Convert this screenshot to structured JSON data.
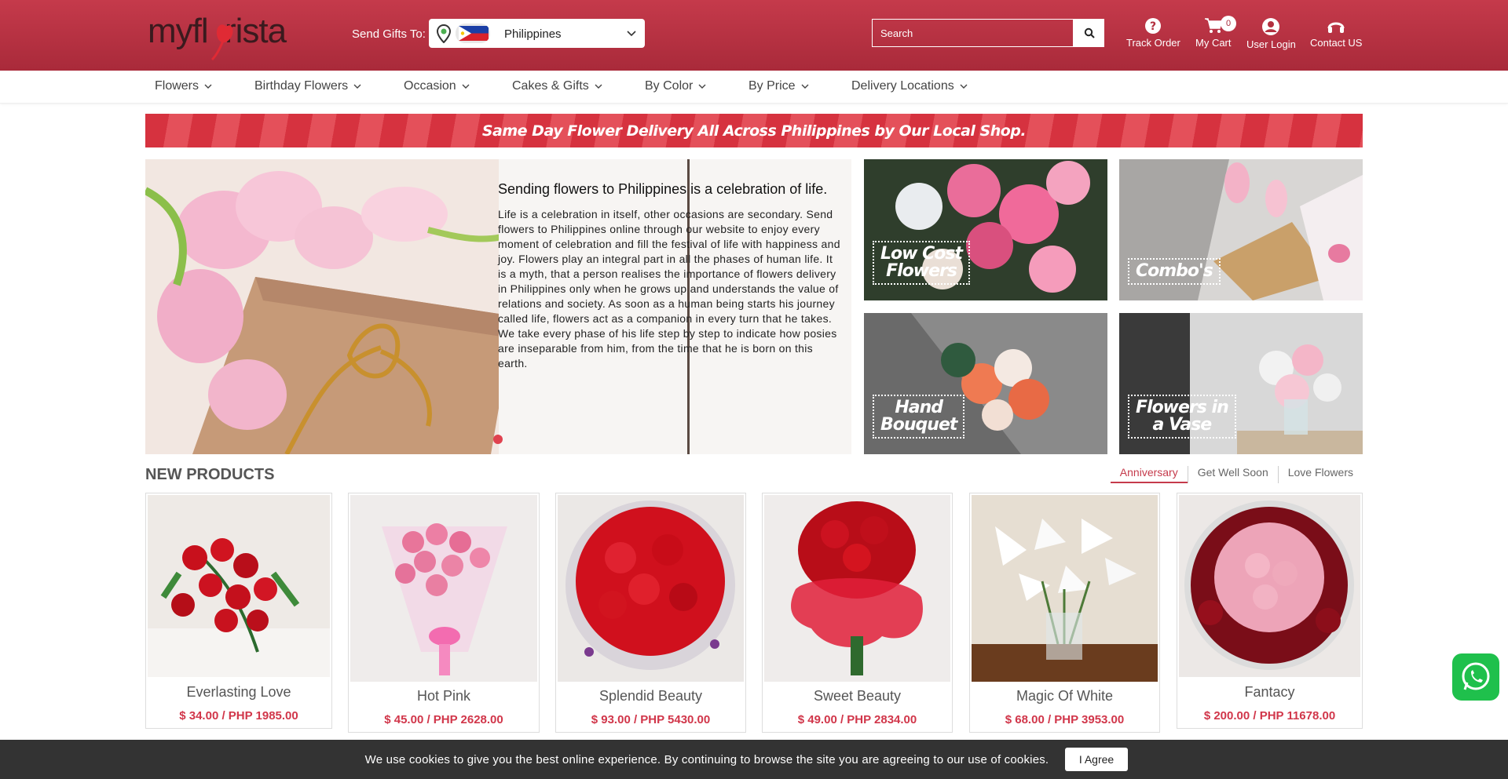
{
  "header": {
    "logo_text": "myflorista",
    "send_gifts_label": "Send Gifts To:",
    "country": "Philippines",
    "search_placeholder": "Search",
    "track_order": "Track Order",
    "my_cart": "My Cart",
    "cart_count": "0",
    "user_login": "User Login",
    "contact_us": "Contact US"
  },
  "nav": {
    "items": [
      "Flowers",
      "Birthday Flowers",
      "Occasion",
      "Cakes & Gifts",
      "By Color",
      "By Price",
      "Delivery Locations"
    ]
  },
  "strip_text": "Same Day Flower Delivery All Across Philippines by Our Local Shop.",
  "hero": {
    "title": "Sending flowers to Philippines is a celebration of life.",
    "body": "Life is a celebration in itself, other occasions are secondary. Send flowers to Philippines online through our website to enjoy every moment of celebration and fill the festival of life with happiness and joy. Flowers play an integral part in all the phases of human life. It is a myth, that a person realises the importance of flowers delivery in Philippines only when he grows up and understands the value of relations and society. As soon as a human being starts his journey called life, flowers act as a companion in every turn that he takes. We take every phase of his life step by step to indicate how posies are inseparable from him, from the time that he is born on this earth."
  },
  "tiles": {
    "low_cost_1": "Low Cost",
    "low_cost_2": "Flowers",
    "combos": "Combo's",
    "hand_1": "Hand",
    "hand_2": "Bouquet",
    "vase_1": "Flowers in",
    "vase_2": "a Vase"
  },
  "new_products": {
    "title": "NEW PRODUCTS",
    "tabs": [
      "Anniversary",
      "Get Well Soon",
      "Love Flowers"
    ],
    "items": [
      {
        "name": "Everlasting Love",
        "price": "$ 34.00 / PHP 1985.00"
      },
      {
        "name": "Hot Pink",
        "price": "$ 45.00 / PHP 2628.00"
      },
      {
        "name": "Splendid Beauty",
        "price": "$ 93.00 / PHP 5430.00"
      },
      {
        "name": "Sweet Beauty",
        "price": "$ 49.00 / PHP 2834.00"
      },
      {
        "name": "Magic Of White",
        "price": "$ 68.00 / PHP 3953.00"
      },
      {
        "name": "Fantacy",
        "price": "$ 200.00 / PHP 11678.00"
      }
    ]
  },
  "cookie": {
    "text": "We use cookies to give you the best online experience. By continuing to browse the site you are agreeing to our use of cookies.",
    "button": "I Agree"
  },
  "colors": {
    "brand_red": "#c53a4b",
    "price_red": "#d1364a",
    "whatsapp_green": "#1fc04c"
  }
}
